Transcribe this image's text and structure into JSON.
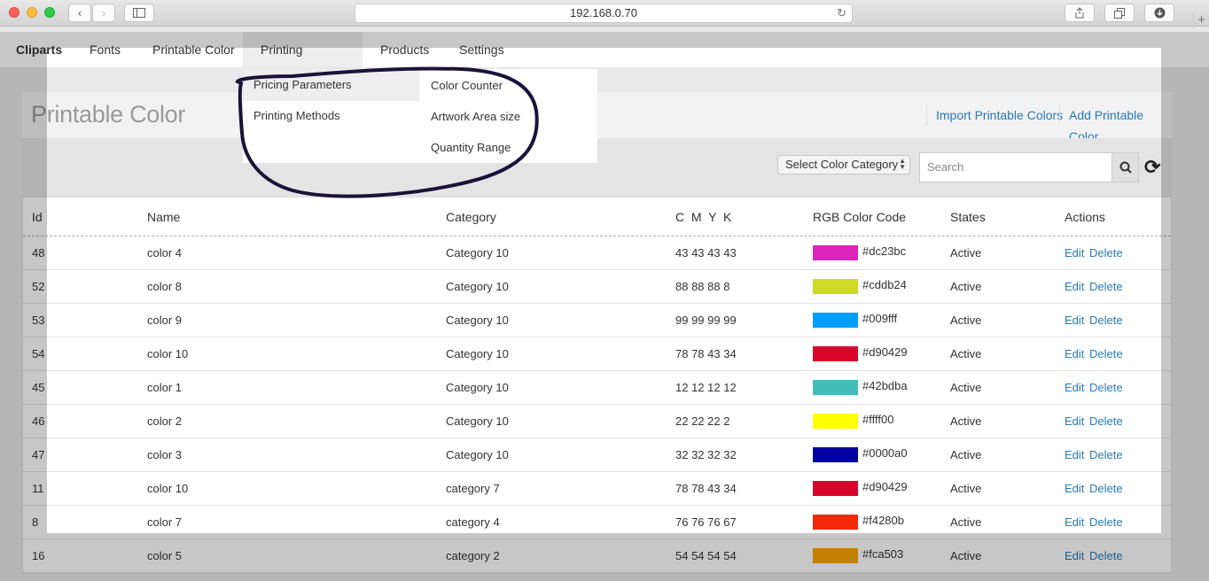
{
  "browser": {
    "address": "192.168.0.70"
  },
  "topnav": {
    "items": [
      "Cliparts",
      "Fonts",
      "Printable Color",
      "Printing Methods",
      "Products",
      "Settings"
    ]
  },
  "dropdown": {
    "left": [
      "Pricing Parameters",
      "Printing Methods"
    ],
    "right": [
      "Color Counter",
      "Artwork Area size",
      "Quantity Range"
    ]
  },
  "page": {
    "title": "Printable Color",
    "import_label": "Import Printable Colors",
    "add_label": "Add Printable Color"
  },
  "filters": {
    "category_select": "Select Color Category",
    "search_placeholder": "Search"
  },
  "table": {
    "headers": [
      "Id",
      "Name",
      "Category",
      "C  M  Y  K",
      "RGB Color Code",
      "States",
      "Actions"
    ],
    "edit_label": "Edit",
    "delete_label": "Delete",
    "rows": [
      {
        "id": "48",
        "name": "color 4",
        "category": "Category 10",
        "cmyk": "43 43 43 43",
        "rgb": "#dc23bc",
        "state": "Active"
      },
      {
        "id": "52",
        "name": "color 8",
        "category": "Category 10",
        "cmyk": "88 88 88 8",
        "rgb": "#cddb24",
        "state": "Active"
      },
      {
        "id": "53",
        "name": "color 9",
        "category": "Category 10",
        "cmyk": "99 99 99 99",
        "rgb": "#009fff",
        "state": "Active"
      },
      {
        "id": "54",
        "name": "color 10",
        "category": "Category 10",
        "cmyk": "78 78 43 34",
        "rgb": "#d90429",
        "state": "Active"
      },
      {
        "id": "45",
        "name": "color 1",
        "category": "Category 10",
        "cmyk": "12 12 12 12",
        "rgb": "#42bdba",
        "state": "Active"
      },
      {
        "id": "46",
        "name": "color 2",
        "category": "Category 10",
        "cmyk": "22 22 22 2",
        "rgb": "#ffff00",
        "state": "Active"
      },
      {
        "id": "47",
        "name": "color 3",
        "category": "Category 10",
        "cmyk": "32 32 32 32",
        "rgb": "#0000a0",
        "state": "Active"
      },
      {
        "id": "11",
        "name": "color 10",
        "category": "category 7",
        "cmyk": "78 78 43 34",
        "rgb": "#d90429",
        "state": "Active"
      },
      {
        "id": "8",
        "name": "color 7",
        "category": "category 4",
        "cmyk": "76 76 76 67",
        "rgb": "#f4280b",
        "state": "Active"
      },
      {
        "id": "16",
        "name": "color 5",
        "category": "category 2",
        "cmyk": "54 54 54 54",
        "rgb": "#fca503",
        "state": "Active"
      }
    ]
  },
  "colors": {
    "link": "#2a7ab8",
    "annotation_stroke": "#1a1238"
  }
}
